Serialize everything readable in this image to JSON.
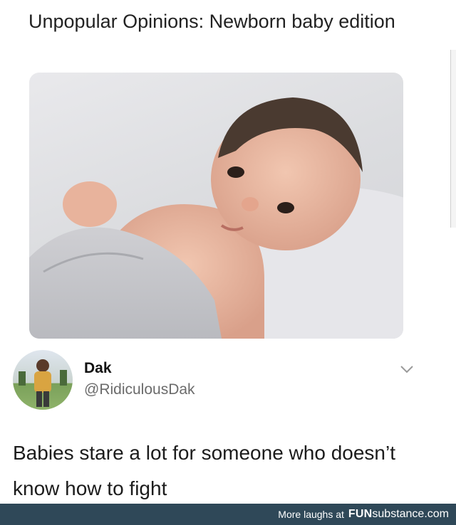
{
  "post": {
    "title": "Unpopular Opinions: Newborn baby edition"
  },
  "tweet": {
    "name": "Dak",
    "handle": "@RidiculousDak",
    "text": "Babies stare a lot for someone who doesn’t know how to fight",
    "menu_icon": "chevron-down-icon"
  },
  "footer": {
    "prefix": "More laughs at",
    "brand_bold": "FUN",
    "brand_rest": "substance.com"
  },
  "colors": {
    "footer_bg": "#2f4858",
    "handle_gray": "#6b6b6b"
  }
}
